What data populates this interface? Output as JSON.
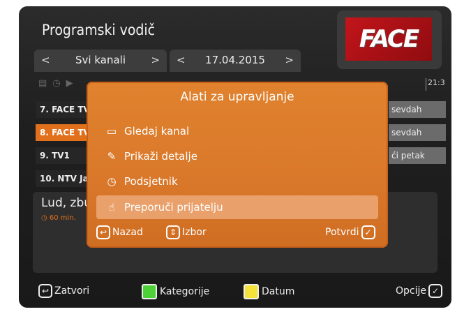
{
  "header": {
    "title": "Programski vodič"
  },
  "filters": {
    "channel_group": "Svi kanali",
    "date": "17.04.2015",
    "left_arrow": "<",
    "right_arrow": ">"
  },
  "timeline": {
    "time": "21:3"
  },
  "channels": [
    {
      "label": "7. FACE TV"
    },
    {
      "label": "8. FACE TV"
    },
    {
      "label": "9. TV1"
    },
    {
      "label": "10. NTV Ja"
    }
  ],
  "programs": [
    {
      "label": "sevdah"
    },
    {
      "label": "sevdah"
    },
    {
      "label": "ći petak"
    }
  ],
  "details": {
    "title": "Lud, zbu",
    "duration": "60 min."
  },
  "modal": {
    "title": "Alati za upravljanje",
    "items": [
      {
        "label": "Gledaj kanal",
        "icon": "tv-icon"
      },
      {
        "label": "Prikaži detalje",
        "icon": "edit-icon"
      },
      {
        "label": "Podsjetnik",
        "icon": "clock-icon"
      },
      {
        "label": "Preporuči prijatelju",
        "icon": "thumbs-up-icon"
      }
    ],
    "back_label": "Nazad",
    "select_label": "Izbor",
    "confirm_label": "Potvrdi"
  },
  "footer": {
    "close_label": "Zatvori",
    "categories_label": "Kategorije",
    "date_label": "Datum",
    "options_label": "Opcije"
  },
  "colors": {
    "accent": "#e0701c",
    "green_key": "#4cd137",
    "yellow_key": "#f5e23a",
    "logo_red": "#c2151b"
  },
  "logo": {
    "text": "FACE"
  }
}
